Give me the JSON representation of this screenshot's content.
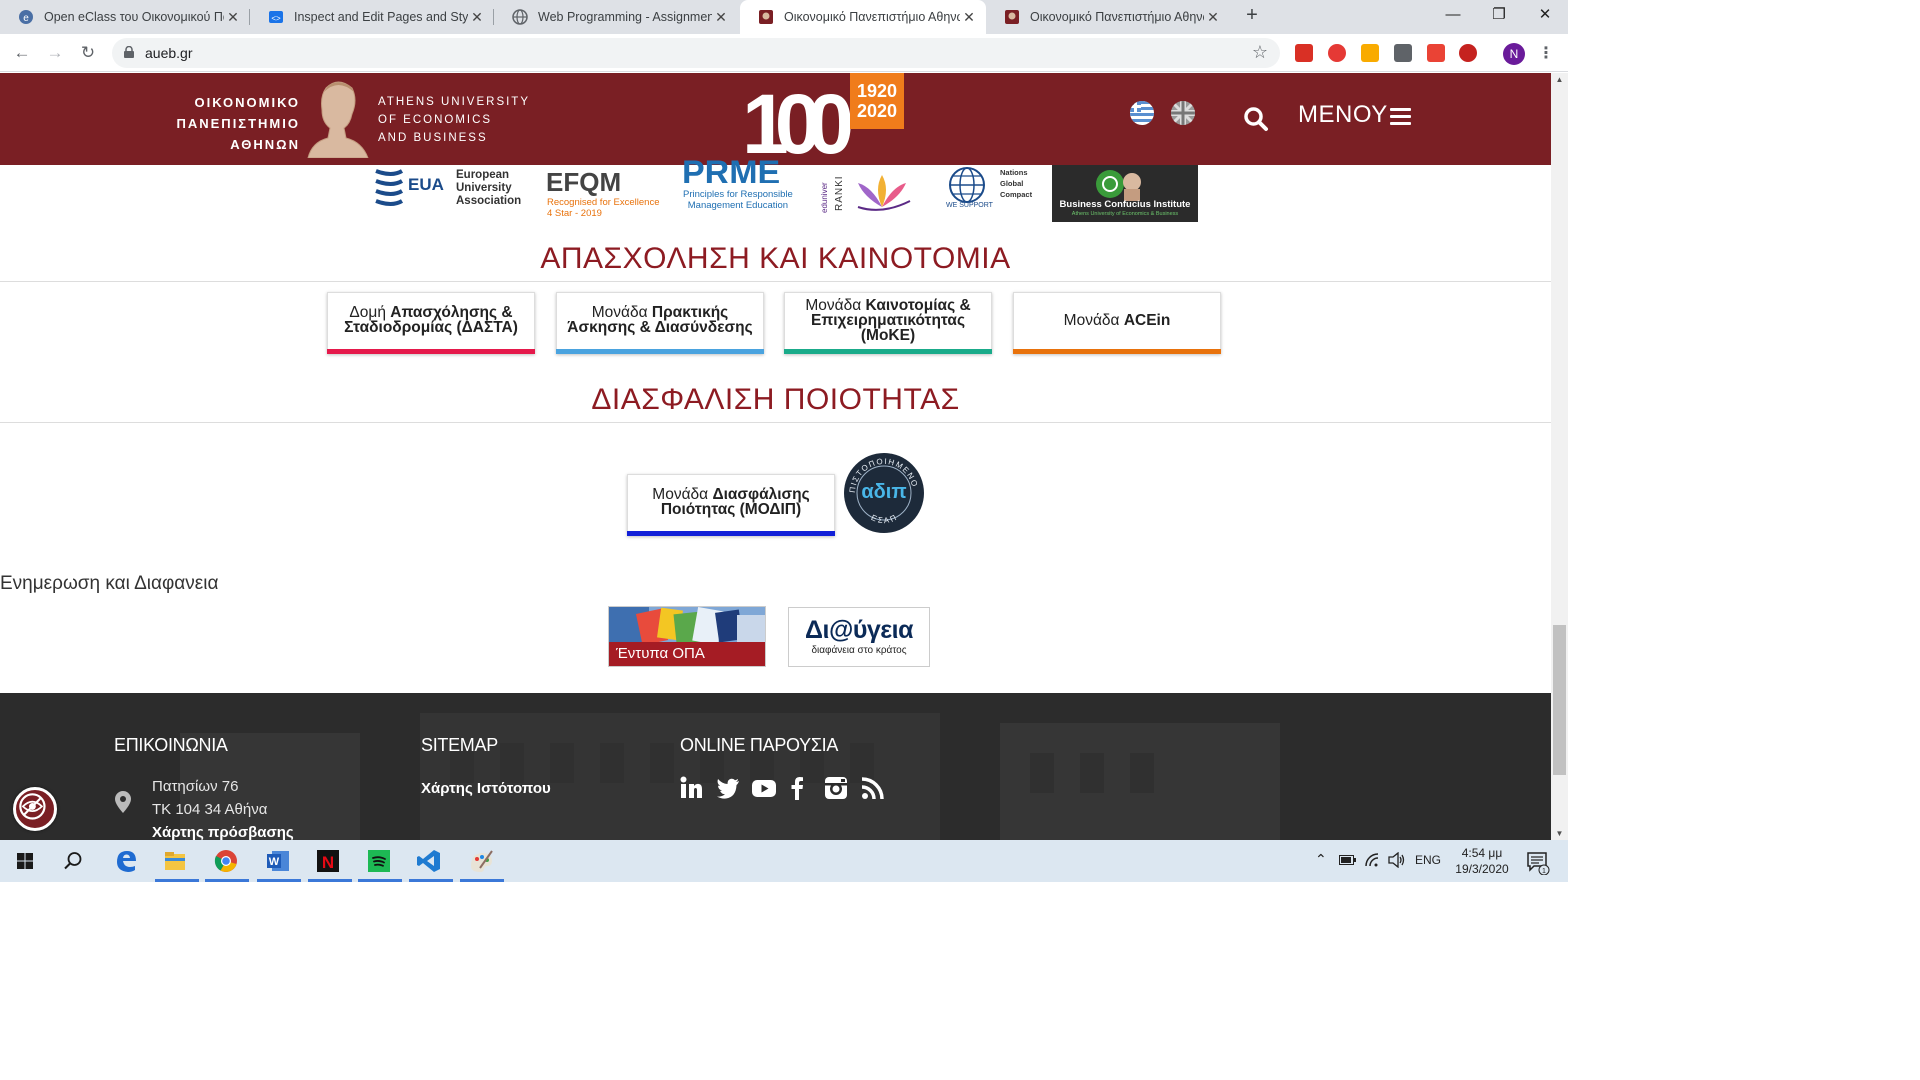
{
  "browser": {
    "tabs": [
      {
        "title": "Open eClass του Οικονομικού Πανεπιστημίου",
        "icon": "eclass-favicon"
      },
      {
        "title": "Inspect and Edit Pages and Styles",
        "icon": "devtools-favicon"
      },
      {
        "title": "Web Programming - Assignment",
        "icon": "globe-favicon"
      },
      {
        "title": "Οικονομικό Πανεπιστήμιο Αθηνών",
        "icon": "aueb-favicon"
      },
      {
        "title": "Οικονομικό Πανεπιστήμιο Αθηνών",
        "icon": "aueb-favicon"
      }
    ],
    "active_tab": 3,
    "url": "aueb.gr",
    "profile_initial": "N",
    "new_tab": "+",
    "window_buttons": {
      "minimize": "—",
      "maximize": "❐",
      "close": "✕"
    }
  },
  "site": {
    "logo_gr_lines": [
      "ΟΙΚΟΝΟΜΙΚΟ",
      "ΠΑΝΕΠΙΣΤΗΜΙΟ",
      "ΑΘΗΝΩΝ"
    ],
    "logo_en_lines": [
      "ATHENS UNIVERSITY",
      "OF ECONOMICS",
      "AND BUSINESS"
    ],
    "anniversary": {
      "number": "100",
      "years_top": "1920",
      "years_bottom": "2020"
    },
    "menu_label": "ΜΕΝΟΥ",
    "brand_color": "#7a1f24",
    "accreditation_logos": [
      {
        "name": "EUA",
        "text": [
          "European",
          "University",
          "Association"
        ]
      },
      {
        "name": "EFQM",
        "text": [
          "Recognised for Excellence",
          "4 Star - 2019"
        ]
      },
      {
        "name": "PRME",
        "text": [
          "Principles for Responsible",
          "Management Education"
        ]
      },
      {
        "name": "Eduniversal",
        "text": [
          "eduniver",
          "RANKI"
        ]
      },
      {
        "name": "UN Global Compact",
        "text": [
          "Nations",
          "Global",
          "Compact",
          "WE SUPPORT"
        ]
      },
      {
        "name": "Business Confucius Institute",
        "text": [
          "Business Confucius Institute",
          "Athens University of Economics & Business"
        ]
      }
    ],
    "section_employment": {
      "title": "ΑΠΑΣΧΟΛΗΣΗ ΚΑΙ ΚΑΙΝΟΤΟΜΙΑ",
      "units": [
        {
          "prefix": "Δομή ",
          "bold": "Απασχόλησης & Σταδιοδρομίας (ΔΑΣΤΑ)",
          "color": "#e5194b"
        },
        {
          "prefix": "Μονάδα ",
          "bold": "Πρακτικής Άσκησης & Διασύνδεσης",
          "color": "#4aa3df"
        },
        {
          "prefix": "Μονάδα ",
          "bold": "Καινοτομίας & Επιχειρηματικότητας (ΜοΚΕ)",
          "color": "#1aab8a"
        },
        {
          "prefix": "Μονάδα ",
          "bold": "ACEin",
          "color": "#e8720c"
        }
      ]
    },
    "section_quality": {
      "title": "ΔΙΑΣΦΑΛΙΣΗ ΠΟΙΟΤΗΤΑΣ",
      "unit": {
        "prefix": "Μονάδα ",
        "bold": "Διασφάλισης Ποιότητας (ΜΟΔΙΠ)",
        "color": "#1220d8"
      },
      "seal": {
        "ring_top": "ΠΙΣΤΟΠΟΙΗΜΕΝΟ",
        "center": "αδιπ",
        "ring_bottom": "ΕΣΑΠ"
      }
    },
    "transparency": {
      "title": "Ενημερωση και Διαφανεια",
      "opa_label": "Έντυπα ΟΠΑ",
      "diavgeia_title": "Δι@ύγεια",
      "diavgeia_subtitle": "διαφάνεια στο κράτος"
    },
    "footer": {
      "contact_title": "ΕΠΙΚΟΙΝΩΝΙΑ",
      "address_line1": "Πατησίων 76",
      "address_line2": "ΤΚ 104 34 Αθήνα",
      "map_link": "Χάρτης πρόσβασης",
      "sitemap_title": "SITEMAP",
      "sitemap_link": "Χάρτης Ιστότοπου",
      "online_title": "ONLINE ΠΑΡΟΥΣΙΑ",
      "social": [
        "linkedin-icon",
        "twitter-icon",
        "youtube-icon",
        "facebook-icon",
        "instagram-icon",
        "rss-icon"
      ]
    }
  },
  "taskbar": {
    "apps": [
      "windows-start-icon",
      "search-icon",
      "edge-icon",
      "file-explorer-icon",
      "chrome-icon",
      "word-icon",
      "netflix-icon",
      "spotify-icon",
      "vscode-icon",
      "paint-icon"
    ],
    "lang": "ENG",
    "time": "4:54 μμ",
    "date": "19/3/2020",
    "notifications": "1"
  }
}
